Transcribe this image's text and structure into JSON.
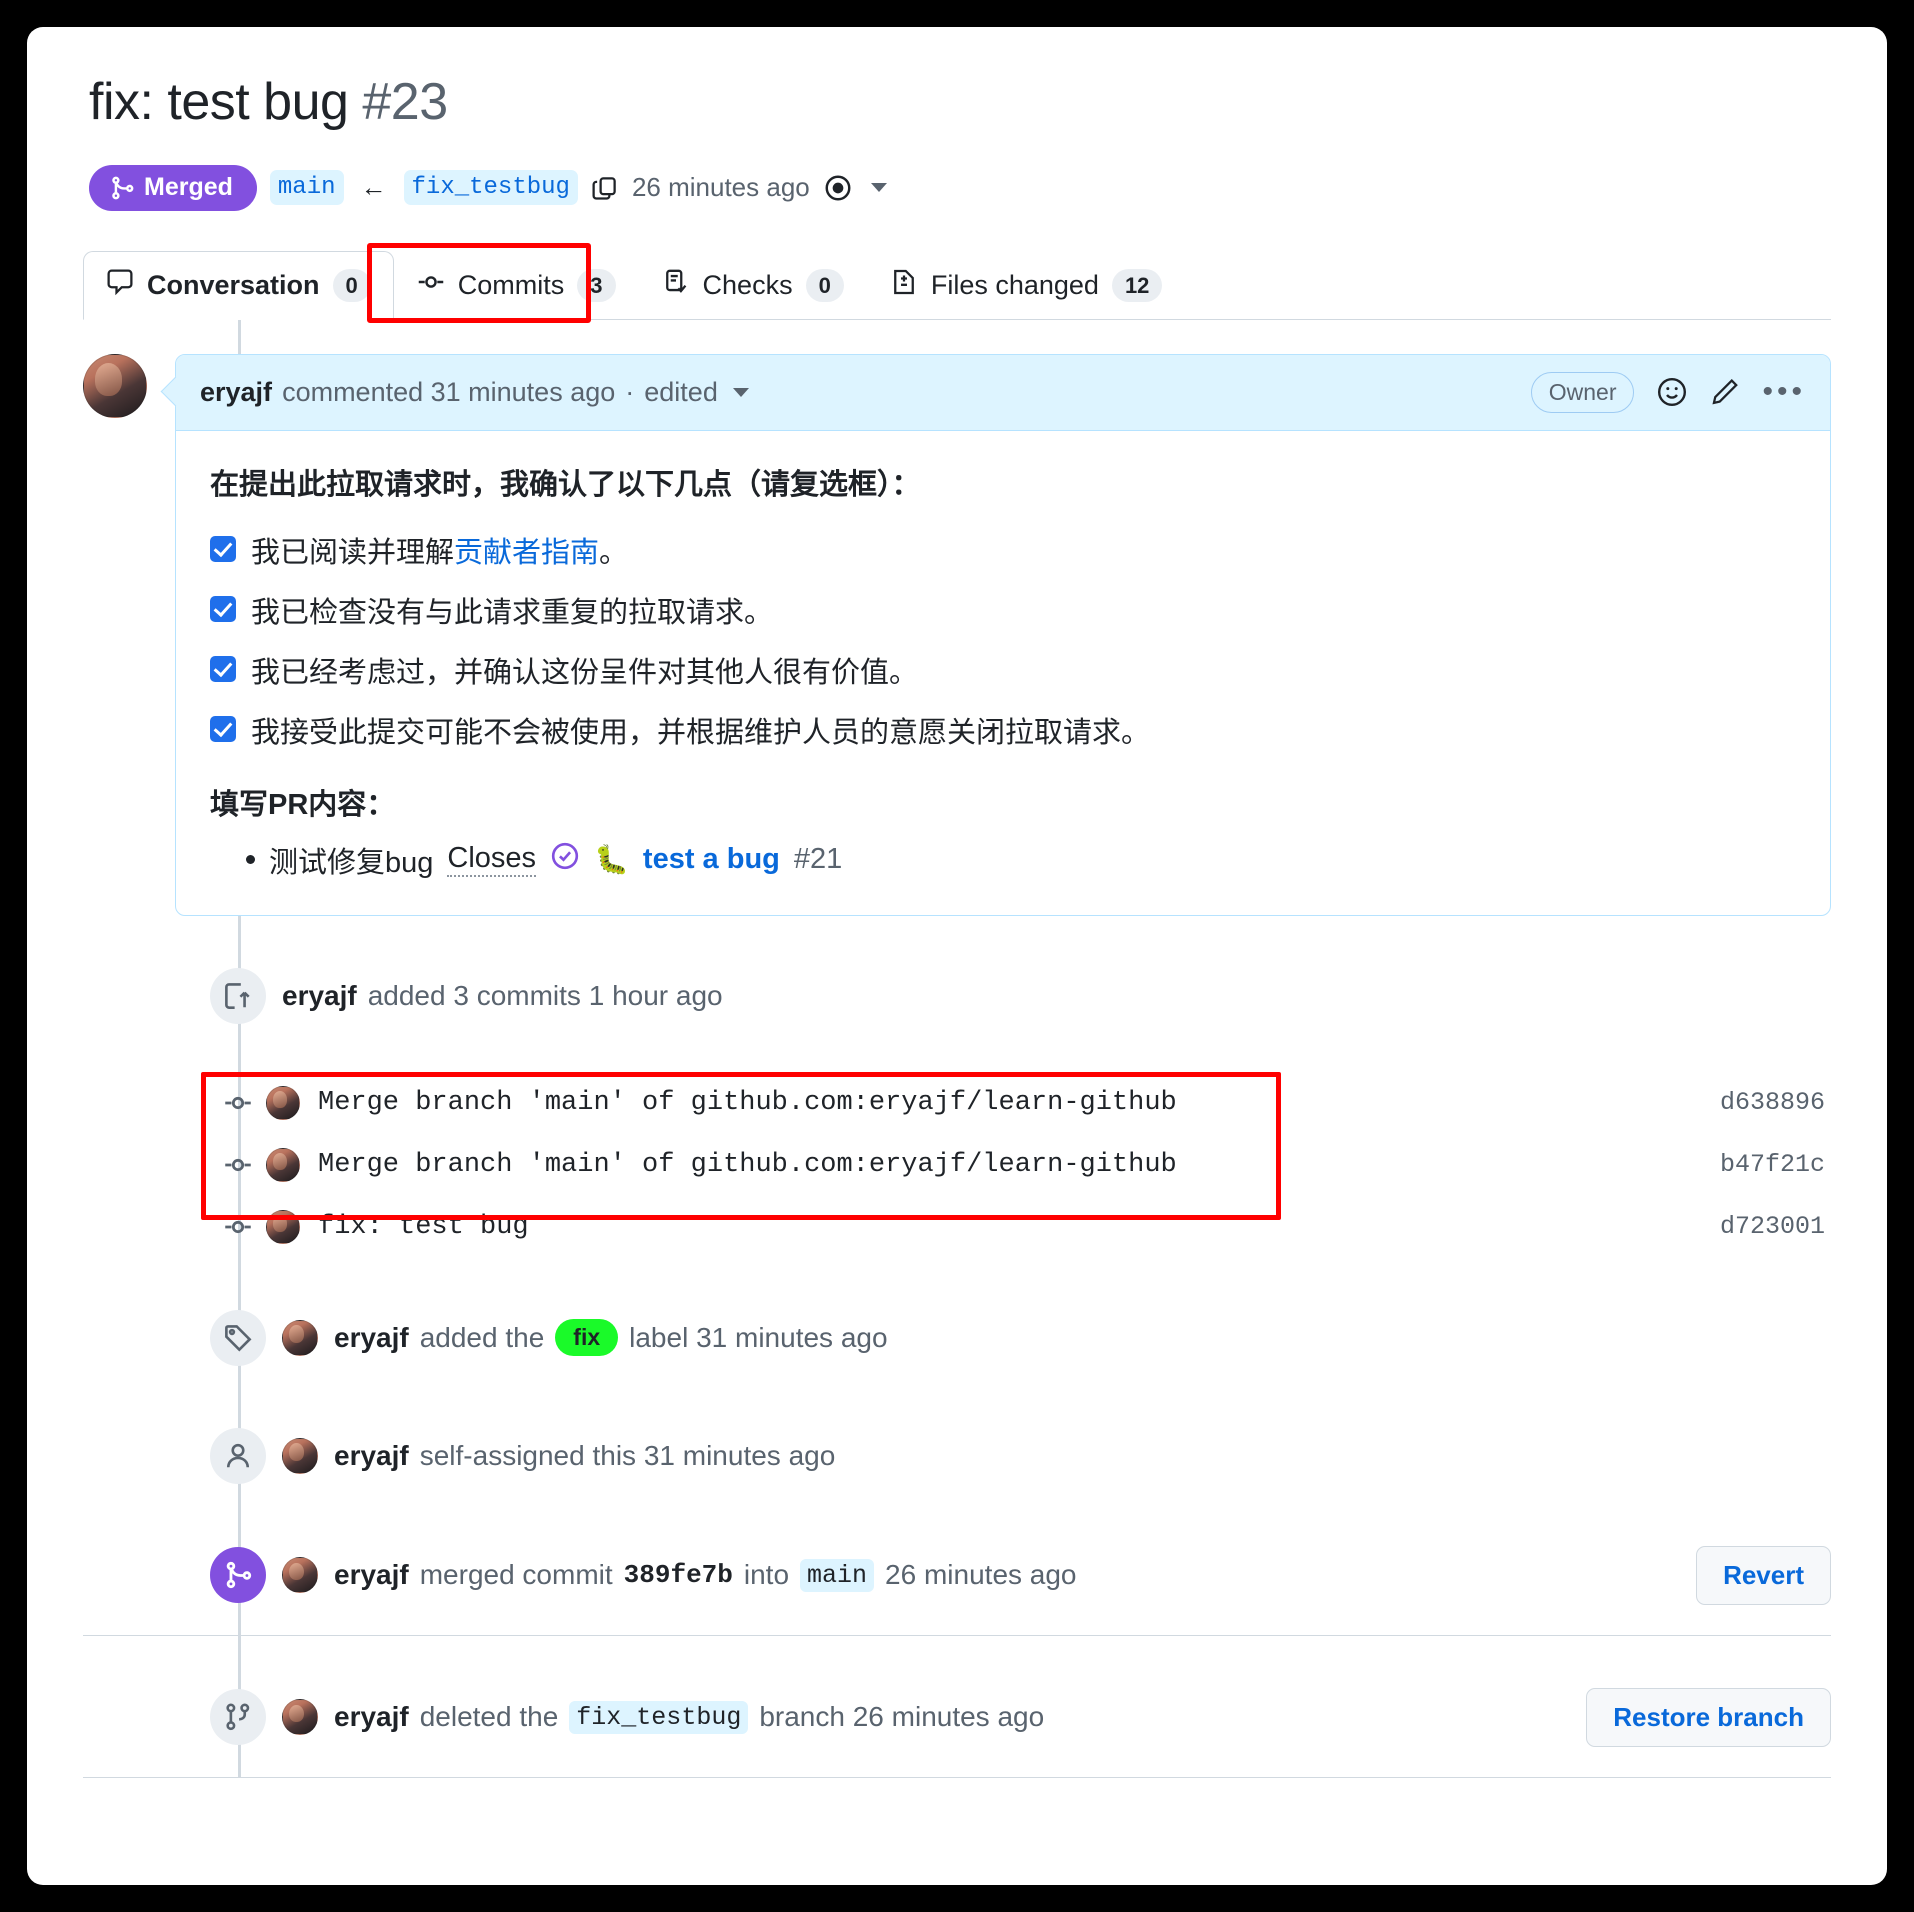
{
  "header": {
    "title": "fix: test bug",
    "number": "#23",
    "state": "Merged",
    "base_branch": "main",
    "arrow": "←",
    "head_branch": "fix_testbug",
    "merged_time": "26 minutes ago"
  },
  "tabs": [
    {
      "label": "Conversation",
      "count": "0",
      "icon": "comment-icon",
      "active": true
    },
    {
      "label": "Commits",
      "count": "3",
      "icon": "commit-icon",
      "active": false
    },
    {
      "label": "Checks",
      "count": "0",
      "icon": "checks-icon",
      "active": false
    },
    {
      "label": "Files changed",
      "count": "12",
      "icon": "diff-icon",
      "active": false
    }
  ],
  "comment": {
    "author": "eryajf",
    "action": "commented 31 minutes ago",
    "separator": "·",
    "edited": "edited",
    "owner_badge": "Owner",
    "body_title": "在提出此拉取请求时，我确认了以下几点（请复选框）：",
    "checklist": [
      {
        "pre": "我已阅读并理解",
        "link": "贡献者指南",
        "post": "。"
      },
      {
        "pre": "我已检查没有与此请求重复的拉取请求。",
        "link": "",
        "post": ""
      },
      {
        "pre": "我已经考虑过，并确认这份呈件对其他人很有价值。",
        "link": "",
        "post": ""
      },
      {
        "pre": "我接受此提交可能不会被使用，并根据维护人员的意愿关闭拉取请求。",
        "link": "",
        "post": ""
      }
    ],
    "sub_title": "填写PR内容：",
    "bullet": {
      "text": "测试修复bug",
      "closes": "Closes",
      "issue_title": "test a bug",
      "issue_number": "#21",
      "emoji": "🐛"
    }
  },
  "events": {
    "added_commits": {
      "icon": "commit-push-icon",
      "author": "eryajf",
      "text": "added 3 commits 1 hour ago"
    },
    "commits": [
      {
        "message": "Merge branch 'main' of github.com:eryajf/learn-github",
        "sha": "d638896"
      },
      {
        "message": "Merge branch 'main' of github.com:eryajf/learn-github",
        "sha": "b47f21c"
      },
      {
        "message": "fix: test bug",
        "sha": "d723001"
      }
    ],
    "label_event": {
      "icon": "tag-icon",
      "author": "eryajf",
      "pre": "added the",
      "label": "fix",
      "post": "label 31 minutes ago"
    },
    "assign_event": {
      "icon": "person-icon",
      "author": "eryajf",
      "text": "self-assigned this 31 minutes ago"
    },
    "merged_event": {
      "icon": "merge-icon",
      "author": "eryajf",
      "pre": "merged commit",
      "sha": "389fe7b",
      "mid": "into",
      "branch": "main",
      "post": "26 minutes ago",
      "button": "Revert"
    },
    "deleted_branch_event": {
      "icon": "branch-icon",
      "author": "eryajf",
      "pre": "deleted the",
      "branch": "fix_testbug",
      "post": "branch 26 minutes ago",
      "button": "Restore branch"
    }
  },
  "colors": {
    "merged_purple": "#8250df",
    "link_blue": "#0969da",
    "label_green": "#1afa29",
    "highlight_red": "#ff0000"
  }
}
